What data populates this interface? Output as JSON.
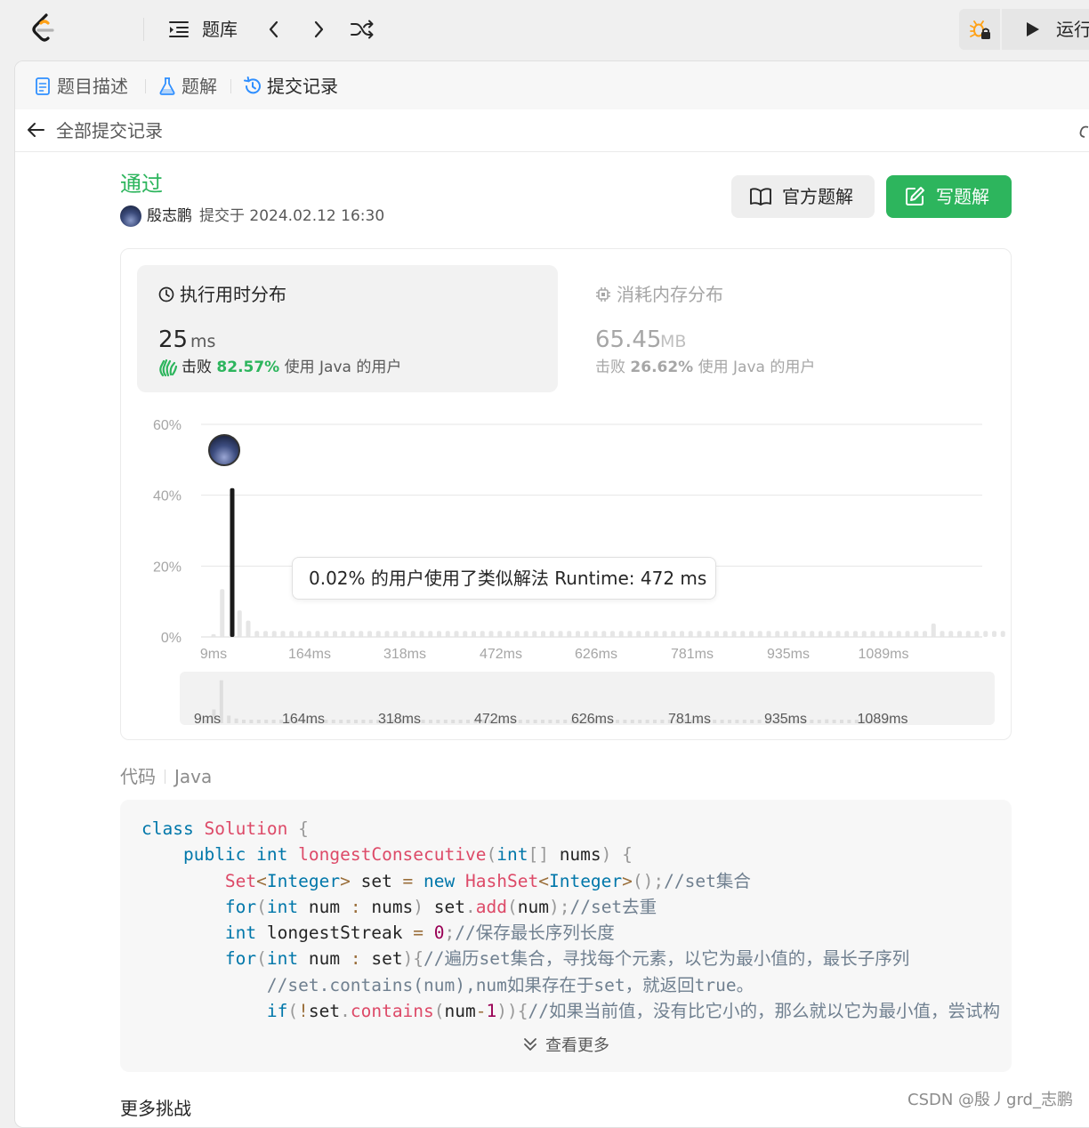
{
  "topbar": {
    "problem_bank_label": "题库",
    "run_label": "运行"
  },
  "tabs": {
    "description": "题目描述",
    "solutions": "题解",
    "submissions": "提交记录"
  },
  "back_label": "全部提交记录",
  "submission": {
    "status": "通过",
    "username": "殷志鹏",
    "submitted_at": "提交于 2024.02.12 16:30"
  },
  "actions": {
    "official_solution": "官方题解",
    "write_solution": "写题解"
  },
  "runtime": {
    "title": "执行用时分布",
    "value": "25",
    "unit": "ms",
    "beat_prefix": "击败",
    "beat_percent": "82.57%",
    "beat_suffix": "使用 Java 的用户"
  },
  "memory": {
    "title": "消耗内存分布",
    "value": "65.45",
    "unit": "MB",
    "beat_prefix": "击败",
    "beat_percent": "26.62%",
    "beat_suffix": "使用 Java 的用户"
  },
  "tooltip_text": "0.02% 的用户使用了类似解法 Runtime: 472 ms",
  "chart_data": {
    "type": "bar",
    "x_labels": [
      "9ms",
      "164ms",
      "318ms",
      "472ms",
      "626ms",
      "781ms",
      "935ms",
      "1089ms"
    ],
    "y_ticks": [
      "60%",
      "40%",
      "20%",
      "0%"
    ],
    "ylim": [
      0,
      60
    ],
    "highlight_bar_index": 2,
    "highlight_value": 42,
    "values": [
      0.8,
      13.5,
      42,
      7.5,
      4.6,
      1.7,
      1.7,
      1.7,
      1.7,
      1.7,
      1.7,
      1.7,
      1.7,
      1.7,
      1.7,
      1.7,
      1.7,
      1.7,
      1.7,
      1.7,
      1.7,
      1.7,
      1.7,
      1.7,
      1.7,
      1.7,
      1.7,
      1.7,
      1.7,
      1.7,
      1.7,
      1.7,
      1.7,
      1.7,
      1.7,
      1.7,
      1.7,
      1.7,
      1.7,
      1.7,
      1.7,
      1.7,
      1.7,
      1.7,
      1.7,
      1.7,
      1.7,
      1.7,
      1.7,
      1.7,
      1.7,
      1.7,
      1.7,
      1.7,
      1.7,
      1.7,
      1.7,
      1.7,
      1.7,
      1.7,
      1.7,
      1.7,
      1.7,
      1.7,
      1.7,
      1.7,
      1.7,
      1.7,
      1.7,
      1.7,
      1.7,
      1.7,
      1.7,
      1.7,
      1.7,
      1.7,
      1.7,
      1.7,
      1.7,
      1.7,
      1.7,
      1.7,
      1.7,
      3.8,
      1.7,
      1.7,
      1.7,
      1.7,
      1.7,
      1.7,
      1.7,
      1.7
    ]
  },
  "code": {
    "label": "代码",
    "language": "Java",
    "show_more": "查看更多"
  },
  "more_challenges": "更多挑战",
  "watermark": "CSDN @殷丿grd_志鹏"
}
